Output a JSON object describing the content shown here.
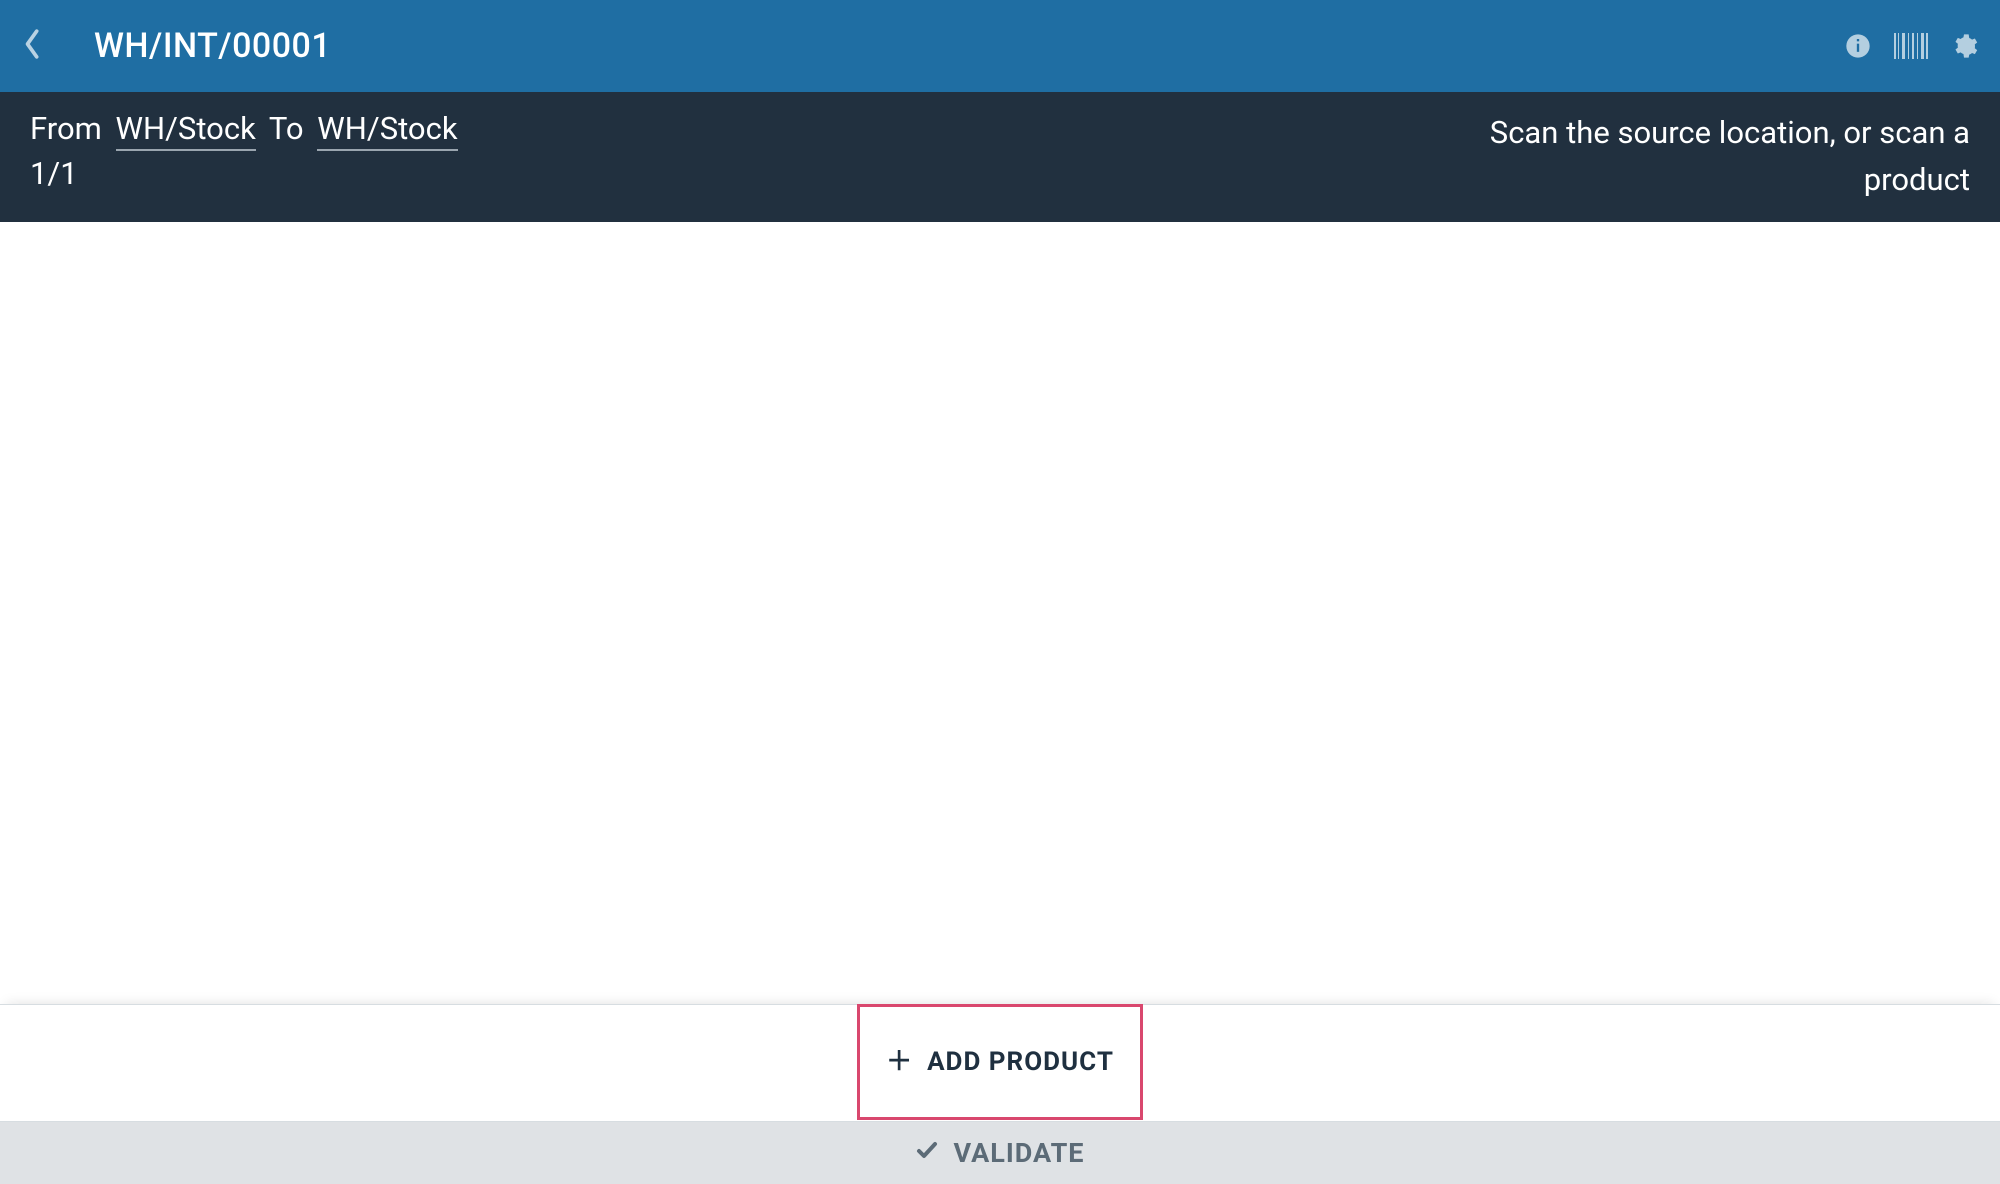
{
  "header": {
    "title": "WH/INT/00001"
  },
  "subheader": {
    "from_label": "From",
    "from_location": "WH/Stock",
    "to_label": "To",
    "to_location": "WH/Stock",
    "pager": "1/1",
    "hint": "Scan the source location, or scan a product"
  },
  "actions": {
    "add_product_label": "ADD PRODUCT",
    "validate_label": "VALIDATE"
  },
  "colors": {
    "primary": "#1f6ea3",
    "dark": "#21303f",
    "accent": "#d9476e",
    "muted": "#dfe2e5"
  }
}
